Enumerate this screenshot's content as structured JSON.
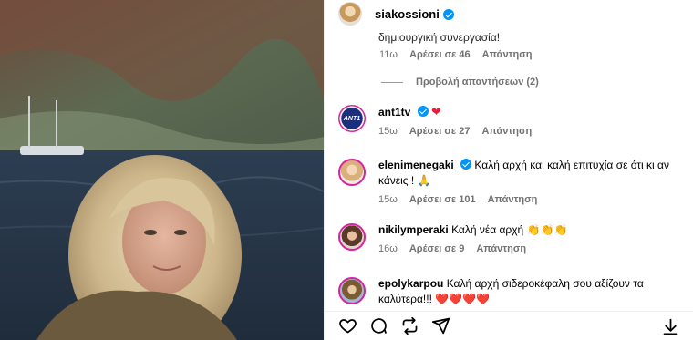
{
  "post": {
    "username": "siakossioni",
    "avatar_icon": "profile-avatar"
  },
  "partial_comment": {
    "text": "δημιουργική συνεργασία!",
    "time": "11ω",
    "likes": "Αρέσει σε 46",
    "reply": "Απάντηση",
    "view_replies": "Προβολή απαντήσεων (2)"
  },
  "comments": [
    {
      "username": "ant1tv",
      "avatar_text": "ΑΝΤ1",
      "verified": true,
      "text": "",
      "time": "15ω",
      "likes": "Αρέσει σε 27",
      "reply": "Απάντηση"
    },
    {
      "username": "elenimenegaki",
      "verified": true,
      "text": "Καλή αρχή και καλή επιτυχία σε ότι κι αν κάνεις ! 🙏",
      "time": "15ω",
      "likes": "Αρέσει σε 101",
      "reply": "Απάντηση"
    },
    {
      "username": "nikilymperaki",
      "verified": false,
      "text": "Καλή νέα αρχή 👏👏👏",
      "time": "16ω",
      "likes": "Αρέσει σε 9",
      "reply": "Απάντηση"
    },
    {
      "username": "epolykarpou",
      "verified": false,
      "text": "Καλή αρχή σιδεροκέφαλη σου αξίζουν τα καλύτερα!!! ❤️❤️❤️❤️",
      "time": "",
      "likes": "",
      "reply": ""
    }
  ],
  "icons": {
    "like": "heart-icon",
    "comment": "comment-icon",
    "repost": "repost-icon",
    "share": "share-icon",
    "save": "save-icon"
  },
  "colors": {
    "verified": "#0095f6",
    "heart": "#ed1c3a",
    "meta_text": "#737373"
  }
}
